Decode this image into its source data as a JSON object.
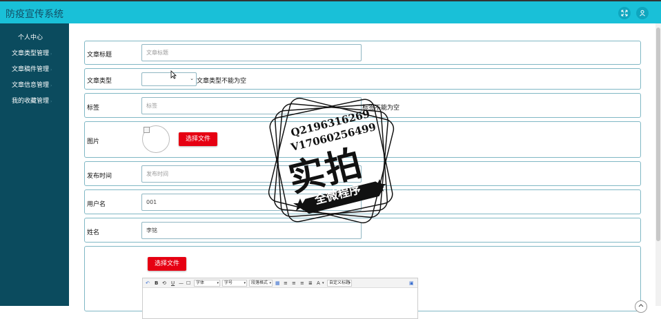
{
  "app": {
    "title": "防疫宣传系统"
  },
  "header": {
    "icons": [
      "fullscreen-icon",
      "user-icon"
    ]
  },
  "sidebar": {
    "items": [
      {
        "label": "个人中心",
        "has_arrow": false
      },
      {
        "label": "文章类型管理",
        "has_arrow": true
      },
      {
        "label": "文章稿件管理",
        "has_arrow": true
      },
      {
        "label": "文章信息管理",
        "has_arrow": true
      },
      {
        "label": "我的收藏管理",
        "has_arrow": true
      }
    ]
  },
  "form": {
    "title": {
      "label": "文章标题",
      "placeholder": "文章标题"
    },
    "type": {
      "label": "文章类型",
      "value": "",
      "error": "文章类型不能为空"
    },
    "tags": {
      "label": "标签",
      "placeholder": "标签",
      "error": "标签不能为空"
    },
    "image": {
      "label": "图片",
      "button": "选择文件"
    },
    "publish_time": {
      "label": "发布时间",
      "placeholder": "发布时间"
    },
    "username": {
      "label": "用户名",
      "value": "001"
    },
    "name": {
      "label": "姓名",
      "value": "李铭"
    },
    "content": {
      "button": "选择文件"
    }
  },
  "editor_toolbar": {
    "bold": "B",
    "underline": "U",
    "font_family": "字体",
    "font_size": "字号",
    "paragraph": "段落格式",
    "font_color": "A",
    "custom_heading": "自定义标题"
  },
  "watermark": {
    "line1": "Q2196316269",
    "line2": "V17060256499",
    "big": "实拍",
    "banner": "全微程序"
  },
  "colors": {
    "header_bg": "#19c0d8",
    "sidebar_bg": "#0b4b5e",
    "accent_button": "#e60012",
    "row_border": "#7fb7c4"
  }
}
